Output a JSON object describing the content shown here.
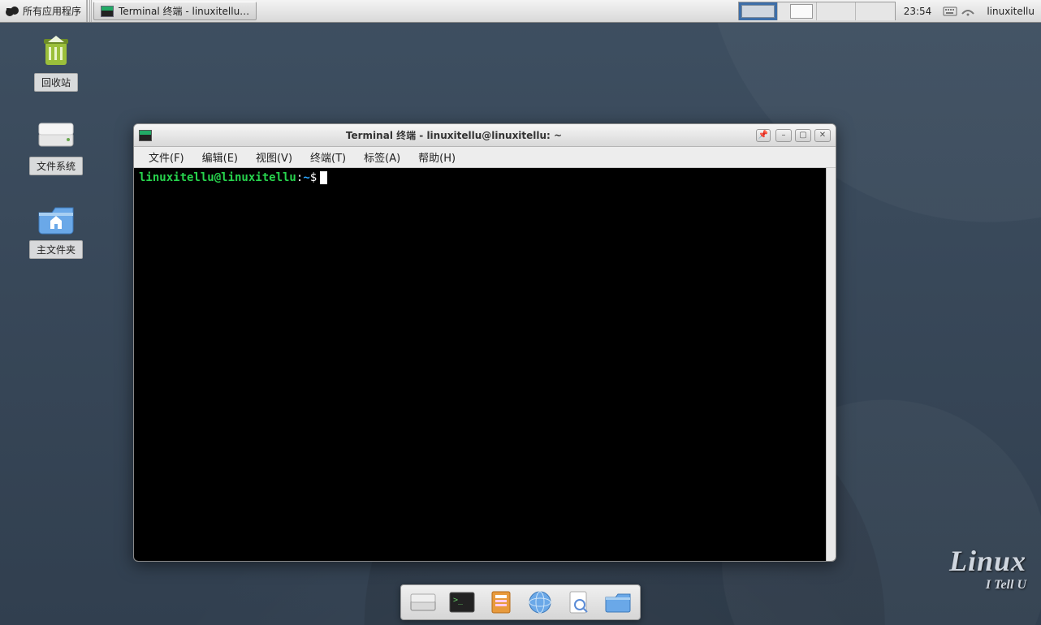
{
  "panel": {
    "apps_menu": "所有应用程序",
    "taskbar_item": "Terminal 终端 - linuxitellu…",
    "clock": "23:54",
    "username": "linuxitellu",
    "workspaces": 4,
    "active_workspace": 1
  },
  "desktop": {
    "icons": [
      {
        "name": "recycle-bin",
        "label": "回收站"
      },
      {
        "name": "filesystem",
        "label": "文件系统"
      },
      {
        "name": "home-folder",
        "label": "主文件夹"
      }
    ]
  },
  "window": {
    "title": "Terminal 终端 - linuxitellu@linuxitellu: ~",
    "menus": [
      "文件(F)",
      "编辑(E)",
      "视图(V)",
      "终端(T)",
      "标签(A)",
      "帮助(H)"
    ],
    "prompt_user": "linuxitellu@linuxitellu",
    "prompt_sep": ":",
    "prompt_path": "~",
    "prompt_symbol": "$"
  },
  "dock": {
    "items": [
      {
        "name": "file-manager-icon"
      },
      {
        "name": "terminal-icon"
      },
      {
        "name": "contacts-icon"
      },
      {
        "name": "web-browser-icon"
      },
      {
        "name": "search-icon"
      },
      {
        "name": "folder-icon"
      }
    ]
  },
  "watermark": {
    "line1": "Linux",
    "line2": "I Tell U"
  }
}
